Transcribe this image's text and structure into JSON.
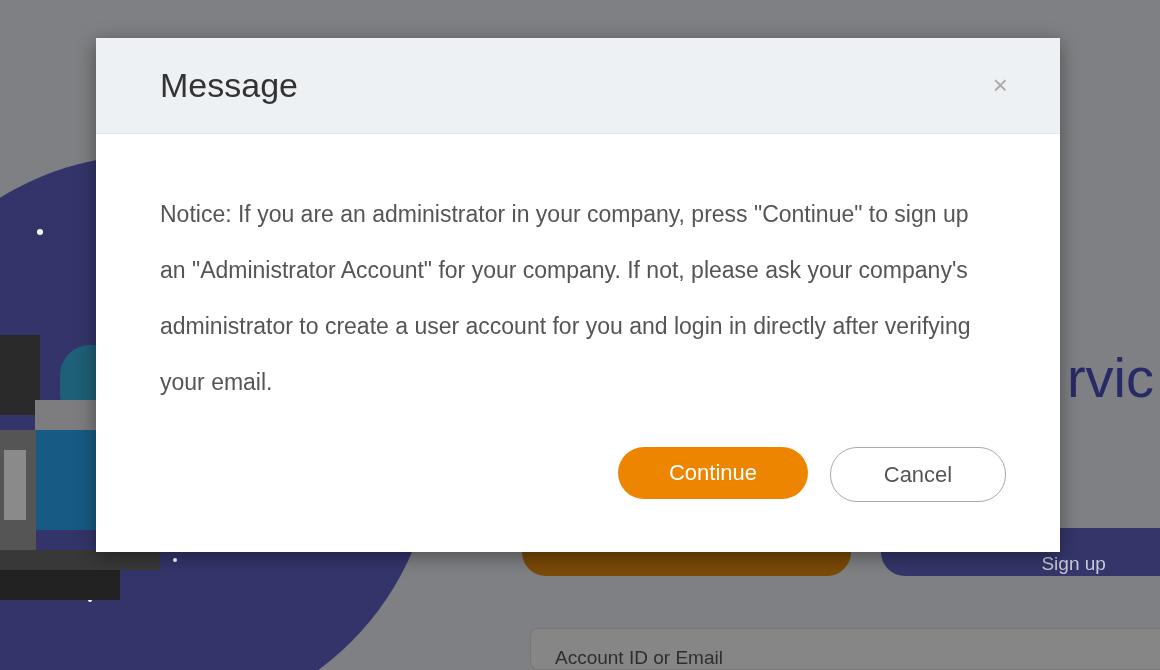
{
  "page": {
    "heading": "rvic",
    "signup_button": "Sign up",
    "account_field": {
      "placeholder": "Account ID or Email"
    }
  },
  "dialog": {
    "title": "Message",
    "close": "×",
    "message": "Notice: If you are an administrator in your company, press \"Continue\" to sign up an \"Administrator Account\" for your company. If not, please ask your company's administrator to create a user account for you and login in directly after verifying your email.",
    "buttons": [
      {
        "label": "Continue",
        "kind": "primary"
      },
      {
        "label": "Cancel",
        "kind": "secondary"
      }
    ]
  }
}
